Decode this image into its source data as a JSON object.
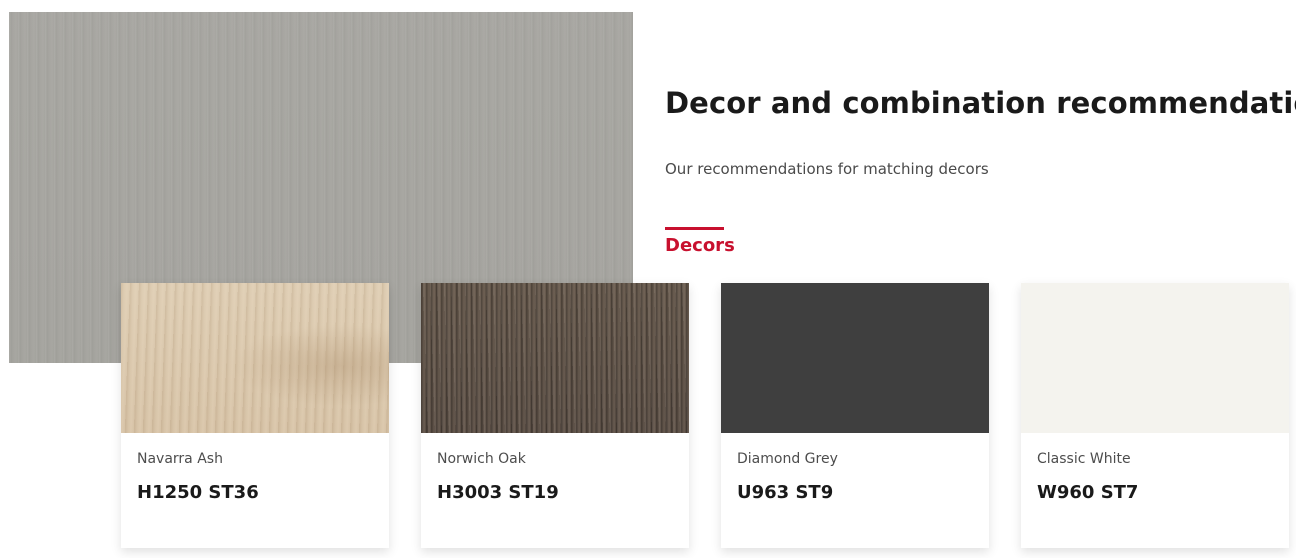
{
  "section": {
    "title": "Decor and combination recommendations",
    "subtitle": "Our recommendations for matching decors",
    "active_tab": "Decors"
  },
  "colors": {
    "accent": "#c8102e",
    "hero_surface": "#a5a49f"
  },
  "cards": [
    {
      "name": "Navarra Ash",
      "code": "H1250 ST36",
      "swatch_color": "#dcc9ae"
    },
    {
      "name": "Norwich Oak",
      "code": "H3003 ST19",
      "swatch_color": "#5e5248"
    },
    {
      "name": "Diamond Grey",
      "code": "U963 ST9",
      "swatch_color": "#3f3f3f"
    },
    {
      "name": "Classic White",
      "code": "W960 ST7",
      "swatch_color": "#f4f3ee"
    }
  ]
}
